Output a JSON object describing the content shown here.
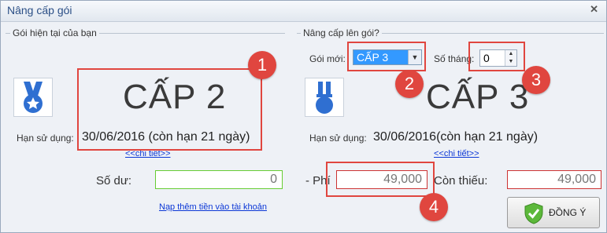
{
  "window": {
    "title": "Nâng cấp gói"
  },
  "current": {
    "group_label": "Gói hiện tại của bạn",
    "level": "CẤP 2",
    "expiry_label": "Hạn sử dụng:",
    "expiry_value": "30/06/2016 (còn hạn 21 ngày)",
    "details_link": "<<chi tiết>>"
  },
  "upgrade": {
    "group_label": "Nâng cấp lên gói?",
    "new_package_label": "Gói mới:",
    "new_package_value": "CẤP 3",
    "months_label": "Số tháng:",
    "months_value": "0",
    "level": "CẤP 3",
    "expiry_label": "Hạn sử dụng:",
    "expiry_value": "30/06/2016(còn hạn 21 ngày)",
    "details_link": "<<chi tiết>>"
  },
  "balance": {
    "label": "Số dư:",
    "value": "0",
    "topup_link": "Nạp thêm tiền vào tài khoản"
  },
  "fee": {
    "label": "- Phí",
    "value": "49,000"
  },
  "shortfall": {
    "label": "Còn thiếu:",
    "value": "49,000"
  },
  "ok_button": {
    "label": "ĐỒNG Ý"
  },
  "annotations": [
    "1",
    "2",
    "3",
    "4"
  ],
  "colors": {
    "annotation": "#e0463f",
    "link": "#0b37d6",
    "title": "#2b4f86",
    "badge_blue": "#2f6fd1"
  }
}
